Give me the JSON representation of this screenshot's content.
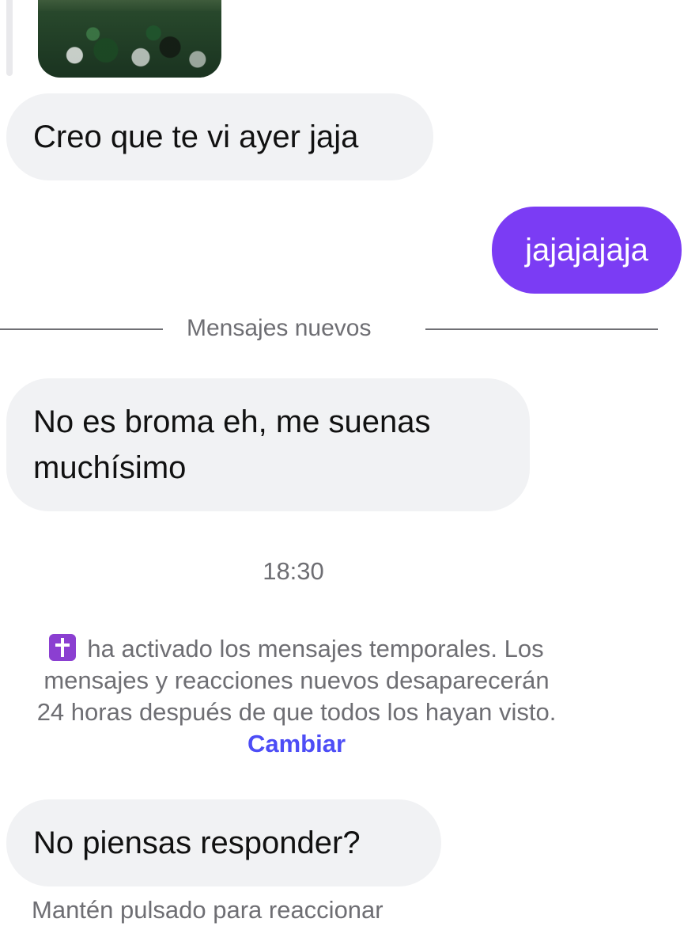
{
  "conversation": {
    "messages": [
      {
        "text": "Creo que te vi ayer jaja",
        "direction": "incoming"
      },
      {
        "text": "jajajajaja",
        "direction": "outgoing"
      },
      {
        "text": "No es broma eh, me suenas muchísimo",
        "direction": "incoming"
      },
      {
        "text": "No piensas responder?",
        "direction": "incoming"
      }
    ],
    "new_messages_label": "Mensajes nuevos",
    "timestamp": "18:30",
    "system_notice": {
      "line1": "ha activado los mensajes temporales. Los",
      "line2": "mensajes y reacciones nuevos desaparecerán",
      "line3": "24 horas después de que todos los hayan visto.",
      "icon": "latin-cross-emoji-icon",
      "action_label": "Cambiar"
    },
    "hint_text": "Mantén pulsado para reaccionar"
  },
  "colors": {
    "incoming_bubble": "#f1f2f4",
    "outgoing_bubble": "#7b3cf4",
    "link": "#4d4df6",
    "muted_text": "#6e6e73",
    "cross_icon": "#8b3fd1"
  }
}
